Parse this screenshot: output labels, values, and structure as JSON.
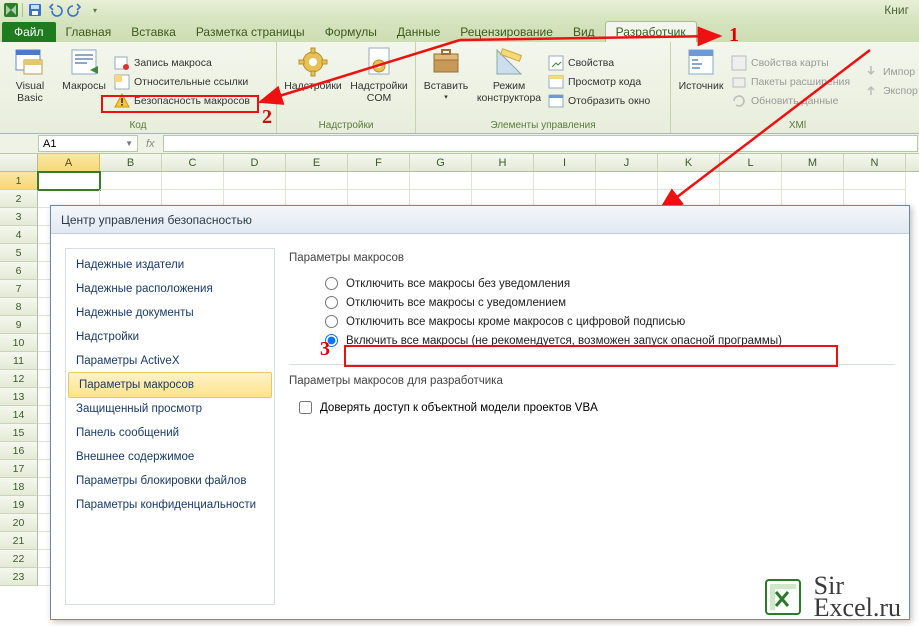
{
  "app_title": "Книг",
  "qat": {
    "save": "save-icon",
    "undo": "undo-icon",
    "redo": "redo-icon"
  },
  "tabs": {
    "file": "Файл",
    "items": [
      "Главная",
      "Вставка",
      "Разметка страницы",
      "Формулы",
      "Данные",
      "Рецензирование",
      "Вид",
      "Разработчик"
    ],
    "active_index": 7
  },
  "ribbon": {
    "code": {
      "vbasic": "Visual\nBasic",
      "macros": "Макросы",
      "record": "Запись макроса",
      "relrefs": "Относительные ссылки",
      "security": "Безопасность макросов",
      "label": "Код"
    },
    "addins": {
      "addins": "Надстройки",
      "com": "Надстройки\nCOM",
      "label": "Надстройки"
    },
    "controls": {
      "insert": "Вставить",
      "design": "Режим\nконструктора",
      "props": "Свойства",
      "viewcode": "Просмотр кода",
      "showwin": "Отобразить окно",
      "label": "Элементы управления"
    },
    "xml": {
      "source": "Источник",
      "mapprops": "Свойства карты",
      "packs": "Пакеты расширения",
      "refresh": "Обновить данные",
      "import": "Импор",
      "export": "Экспор",
      "label": "XMl"
    }
  },
  "namebox": "A1",
  "columns": [
    "A",
    "B",
    "C",
    "D",
    "E",
    "F",
    "G",
    "H",
    "I",
    "J",
    "K",
    "L",
    "M",
    "N"
  ],
  "rows": 23,
  "callouts": {
    "1": "1",
    "2": "2",
    "3": "3"
  },
  "dialog": {
    "title": "Центр управления безопасностью",
    "side": [
      "Надежные издатели",
      "Надежные расположения",
      "Надежные документы",
      "Надстройки",
      "Параметры ActiveX",
      "Параметры макросов",
      "Защищенный просмотр",
      "Панель сообщений",
      "Внешнее содержимое",
      "Параметры блокировки файлов",
      "Параметры конфиденциальности"
    ],
    "side_selected": 5,
    "section1": "Параметры макросов",
    "options": [
      "Отключить все макросы без уведомления",
      "Отключить все макросы с уведомлением",
      "Отключить все макросы кроме макросов с цифровой подписью",
      "Включить все макросы (не рекомендуется, возможен запуск опасной программы)"
    ],
    "selected_option": 3,
    "section2": "Параметры макросов для разработчика",
    "trust_chk": "Доверять доступ к объектной модели проектов VBA"
  },
  "watermark": {
    "line1": "Sir",
    "line2": "Excel.ru"
  }
}
